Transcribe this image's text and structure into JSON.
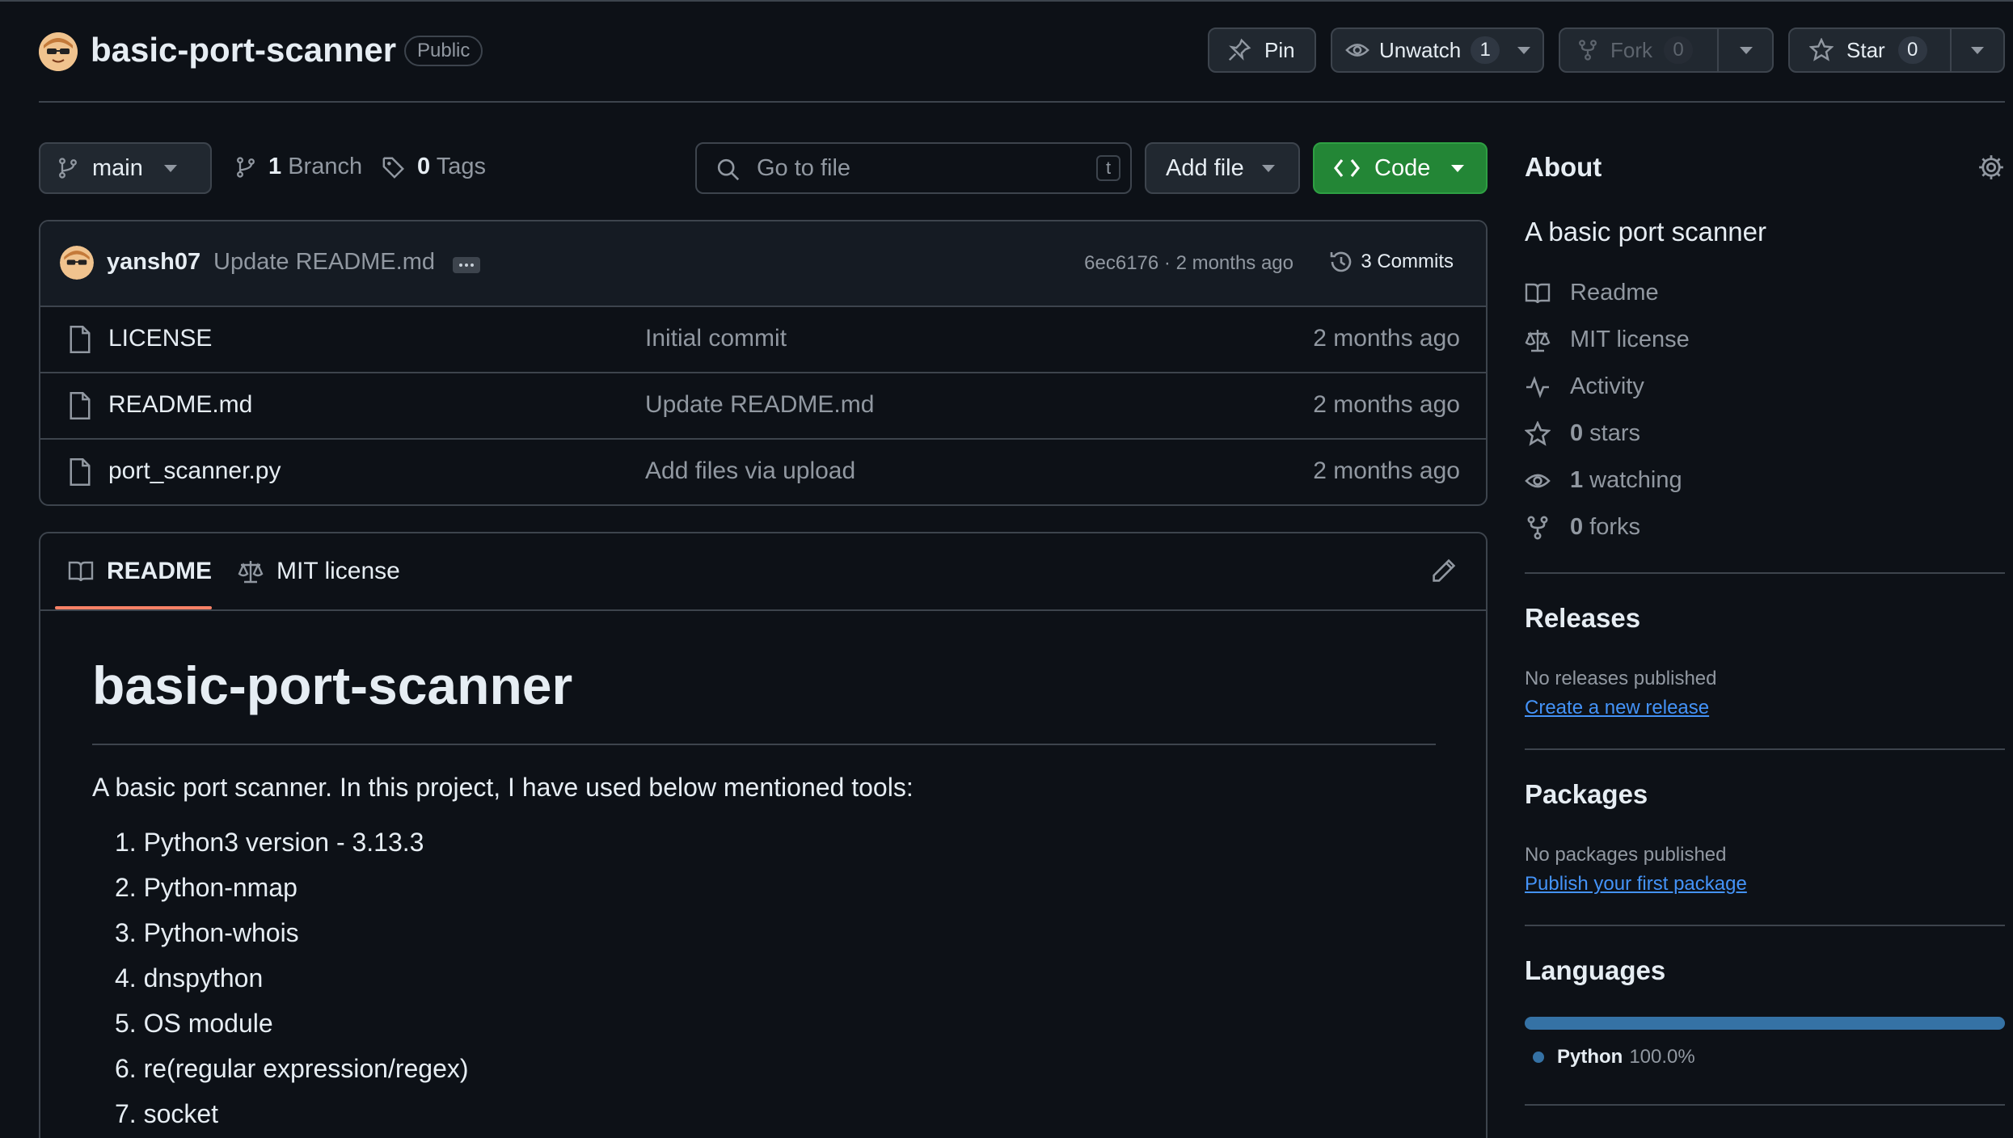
{
  "repo": {
    "name": "basic-port-scanner",
    "visibility": "Public"
  },
  "actions": {
    "pin_label": "Pin",
    "unwatch_label": "Unwatch",
    "watch_count": "1",
    "fork_label": "Fork",
    "fork_count": "0",
    "star_label": "Star",
    "star_count": "0"
  },
  "toolbar": {
    "branch": "main",
    "branch_count": "1",
    "branch_label": "Branch",
    "tag_count": "0",
    "tag_label": "Tags",
    "search_placeholder": "Go to file",
    "search_shortcut": "t",
    "add_file_label": "Add file",
    "code_label": "Code"
  },
  "last_commit": {
    "author": "yansh07",
    "message": "Update README.md",
    "hash_time": "6ec6176 · 2 months ago",
    "commits_label": "3 Commits"
  },
  "files": [
    {
      "name": "LICENSE",
      "message": "Initial commit",
      "time": "2 months ago"
    },
    {
      "name": "README.md",
      "message": "Update README.md",
      "time": "2 months ago"
    },
    {
      "name": "port_scanner.py",
      "message": "Add files via upload",
      "time": "2 months ago"
    }
  ],
  "readme": {
    "tab_readme": "README",
    "tab_license": "MIT license",
    "title": "basic-port-scanner",
    "intro": "A basic port scanner. In this project, I have used below mentioned tools:",
    "tools": [
      "Python3 version - 3.13.3",
      "Python-nmap",
      "Python-whois",
      "dnspython",
      "OS module",
      "re(regular expression/regex)",
      "socket"
    ]
  },
  "about": {
    "heading": "About",
    "description": "A basic port scanner",
    "links": {
      "readme": "Readme",
      "license": "MIT license",
      "activity": "Activity",
      "stars_count": "0",
      "stars_label": "stars",
      "watching_count": "1",
      "watching_label": "watching",
      "forks_count": "0",
      "forks_label": "forks"
    }
  },
  "releases": {
    "heading": "Releases",
    "empty": "No releases published",
    "link": "Create a new release"
  },
  "packages": {
    "heading": "Packages",
    "empty": "No packages published",
    "link": "Publish your first package"
  },
  "languages": {
    "heading": "Languages",
    "items": [
      {
        "name": "Python",
        "percent": "100.0%",
        "share": 1.0,
        "color": "#3572a5"
      }
    ]
  },
  "colors": {
    "bg": "#0d1117",
    "border": "#3d444d",
    "code_button": "#238636",
    "accent_underline": "#f78166",
    "link": "#4493f8"
  }
}
